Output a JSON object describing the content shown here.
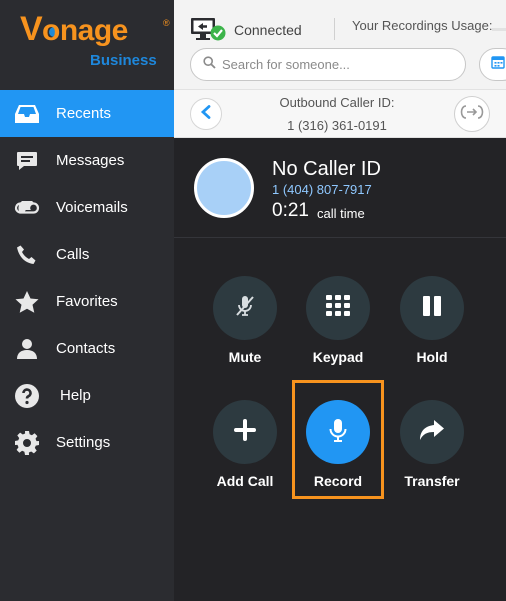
{
  "brand": {
    "name": "Vonage",
    "tagline": "Business"
  },
  "sidebar": {
    "items": [
      {
        "label": "Recents",
        "icon": "inbox-icon",
        "active": true
      },
      {
        "label": "Messages",
        "icon": "chat-bubble-icon",
        "active": false
      },
      {
        "label": "Voicemails",
        "icon": "voicemail-icon",
        "active": false
      },
      {
        "label": "Calls",
        "icon": "phone-icon",
        "active": false
      },
      {
        "label": "Favorites",
        "icon": "star-icon",
        "active": false
      },
      {
        "label": "Contacts",
        "icon": "person-icon",
        "active": false
      },
      {
        "label": "Help",
        "icon": "question-icon",
        "active": false
      },
      {
        "label": "Settings",
        "icon": "gear-icon",
        "active": false
      }
    ]
  },
  "header": {
    "status": "Connected",
    "usage_label": "Your Recordings Usage:",
    "search": {
      "placeholder": "Search for someone..."
    }
  },
  "caller_bar": {
    "label": "Outbound Caller ID:",
    "number": "1 (316) 361-0191"
  },
  "call": {
    "name": "No Caller ID",
    "phone": "1 (404) 807-7917",
    "duration": "0:21",
    "duration_label": "call time"
  },
  "controls": [
    {
      "label": "Mute",
      "icon": "microphone-off-icon"
    },
    {
      "label": "Keypad",
      "icon": "keypad-icon"
    },
    {
      "label": "Hold",
      "icon": "pause-icon"
    },
    {
      "label": "Add Call",
      "icon": "plus-icon"
    },
    {
      "label": "Record",
      "icon": "microphone-icon",
      "active": true
    },
    {
      "label": "Transfer",
      "icon": "forward-arrow-icon"
    }
  ],
  "colors": {
    "accent": "#2196f3",
    "brand_orange": "#f7931e",
    "sidebar_bg": "#2b2c30",
    "panel_bg": "#232326",
    "control_bg": "#2d3a40",
    "connected_green": "#3cb44a",
    "highlight": "#f7931e"
  }
}
